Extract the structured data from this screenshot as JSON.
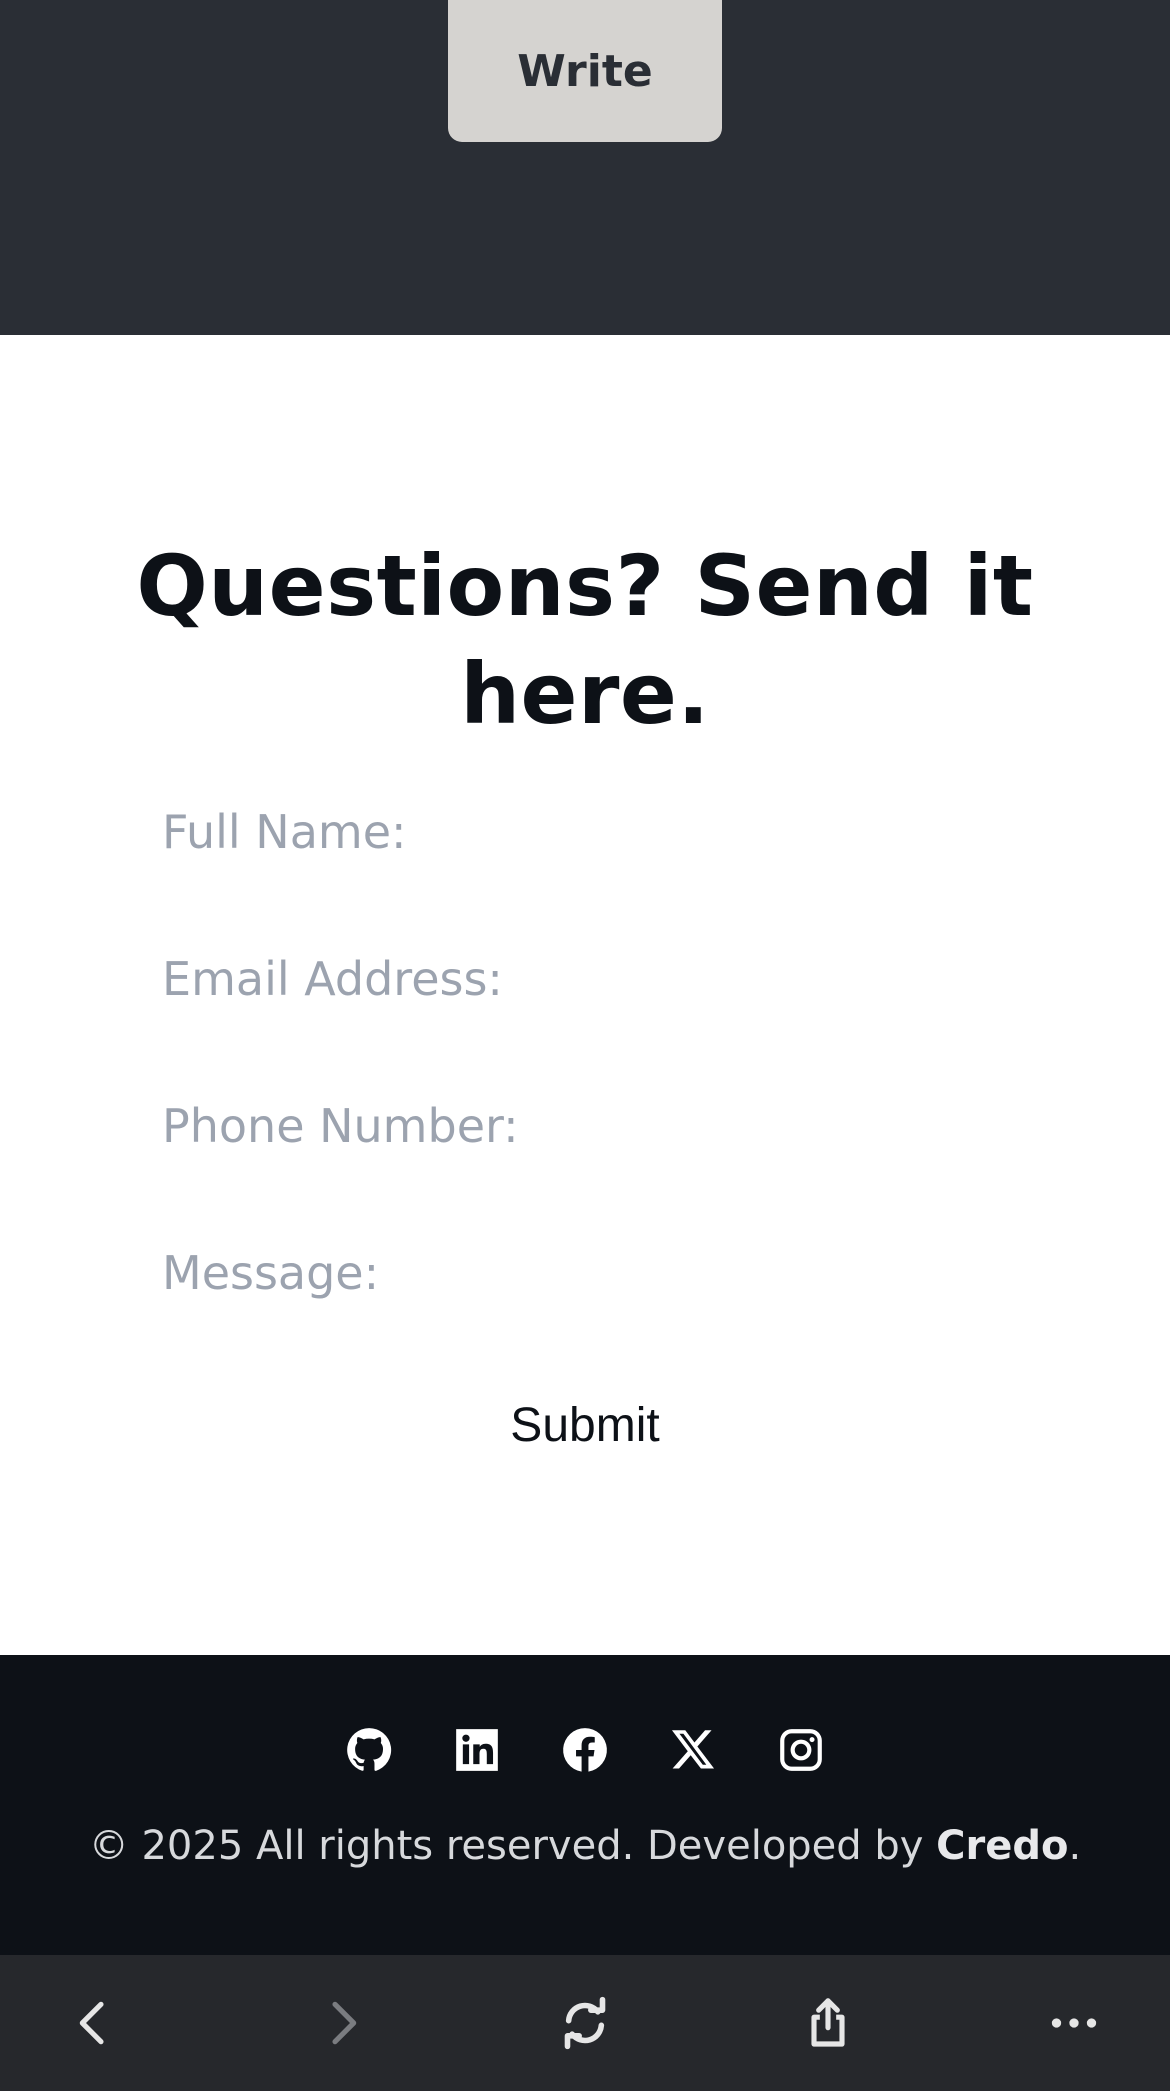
{
  "hero": {
    "write_label": "Write"
  },
  "contact": {
    "title": "Questions? Send it here.",
    "fields": [
      {
        "label": "Full Name:"
      },
      {
        "label": "Email Address:"
      },
      {
        "label": "Phone Number:"
      },
      {
        "label": "Message:"
      }
    ],
    "submit_label": "Submit"
  },
  "footer": {
    "social_icons": [
      "github-icon",
      "linkedin-icon",
      "facebook-icon",
      "x-icon",
      "instagram-icon"
    ],
    "copyright_prefix": "© 2025 All rights reserved. Developed by ",
    "developer": "Credo",
    "copyright_suffix": "."
  },
  "browser_bar": {
    "icons": [
      "back-icon",
      "forward-icon",
      "reload-icon",
      "share-icon",
      "more-icon"
    ]
  },
  "colors": {
    "top_band": "#2a2e35",
    "write_button": "#d5d3d0",
    "footer": "#0d1117",
    "browser_bar": "#26282c",
    "label": "#9ca3af"
  }
}
